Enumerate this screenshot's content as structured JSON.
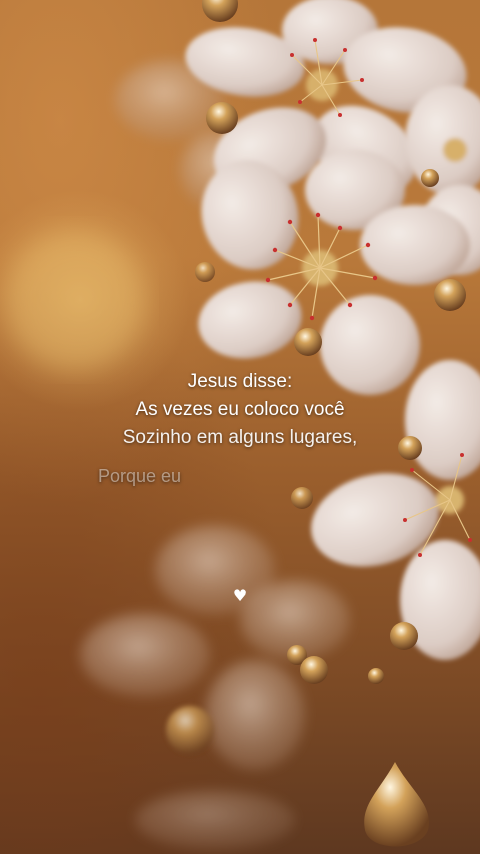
{
  "caption": {
    "line1": "Jesus disse:",
    "line2": "As vezes eu coloco você",
    "line3": "Sozinho em alguns lugares,",
    "line4": "Porque eu"
  },
  "icons": {
    "heart": "white-heart-icon"
  },
  "colors": {
    "background": "#b9793a",
    "petal": "#e9ddd6",
    "stamen": "#c8302f",
    "text": "#ffffff"
  }
}
